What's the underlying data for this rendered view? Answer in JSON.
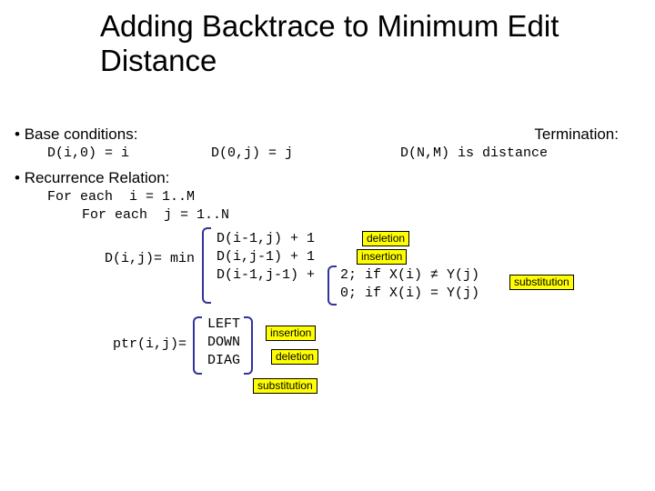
{
  "title": "Adding Backtrace to Minimum Edit Distance",
  "bullets": {
    "base": "Base conditions:",
    "recur": "Recurrence Relation:"
  },
  "base_eq1": "D(i,0) = i",
  "base_eq2": "D(0,j) = j",
  "termination_label": "Termination:",
  "termination_eq": "D(N,M) is distance",
  "loop1": "For each  i = 1..M",
  "loop2": "For each  j = 1..N",
  "dij": "D(i,j)= min",
  "min1": "D(i-1,j) + 1",
  "min2": "D(i,j-1) + 1",
  "min3": "D(i-1,j-1) +",
  "case1": "2; if X(i) ≠ Y(j)",
  "case2": "0; if X(i) = Y(j)",
  "ptr_lhs": "ptr(i,j)=",
  "ptr1": "LEFT",
  "ptr2": "DOWN",
  "ptr3": "DIAG",
  "tag_del": "deletion",
  "tag_ins": "insertion",
  "tag_sub": "substitution"
}
